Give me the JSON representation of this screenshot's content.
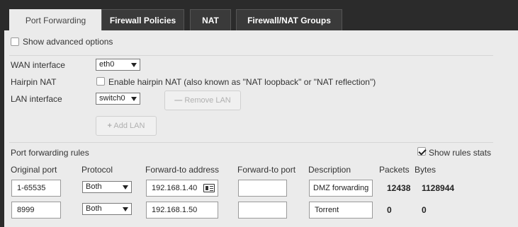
{
  "tabs": [
    {
      "label": "Port Forwarding",
      "active": true
    },
    {
      "label": "Firewall Policies",
      "active": false
    },
    {
      "label": "NAT",
      "active": false
    },
    {
      "label": "Firewall/NAT Groups",
      "active": false
    }
  ],
  "advanced": {
    "label": "Show advanced options",
    "checked": false
  },
  "wan": {
    "label": "WAN interface",
    "value": "eth0"
  },
  "hairpin": {
    "label": "Hairpin NAT",
    "checkbox_label": "Enable hairpin NAT (also known as \"NAT loopback\" or \"NAT reflection\")",
    "checked": false
  },
  "lan": {
    "label": "LAN interface",
    "value": "switch0",
    "remove_label": "Remove LAN",
    "add_label": "Add LAN"
  },
  "rules": {
    "section_label": "Port forwarding rules",
    "show_stats_label": "Show rules stats",
    "show_stats_checked": true,
    "columns": [
      "Original port",
      "Protocol",
      "Forward-to address",
      "Forward-to port",
      "Description",
      "Packets",
      "Bytes"
    ],
    "rows": [
      {
        "original_port": "1-65535",
        "protocol": "Both",
        "forward_address": "192.168.1.40",
        "forward_port": "",
        "description": "DMZ forwarding",
        "packets": "12438",
        "bytes": "1128944"
      },
      {
        "original_port": "8999",
        "protocol": "Both",
        "forward_address": "192.168.1.50",
        "forward_port": "",
        "description": "Torrent",
        "packets": "0",
        "bytes": "0"
      }
    ]
  },
  "colors": {
    "panel_bg": "#ebebeb",
    "tabbar_bg": "#2b2b2b",
    "inactive_tab_bg": "#3a3a3a"
  }
}
